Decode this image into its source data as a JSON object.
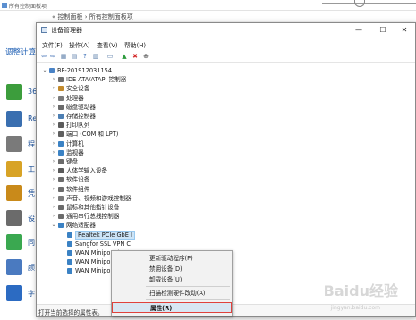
{
  "background": {
    "title": "所有控制面板项",
    "breadcrumb": "« 控制面板 › 所有控制面板项",
    "heading": "调整计算",
    "left_items": [
      {
        "text": "36",
        "color": "#3c9d3c",
        "icon": "shield-icon"
      },
      {
        "text": "Re",
        "color": "#3a6fb0",
        "icon": "users-icon"
      },
      {
        "text": "程",
        "color": "#7a7a7a",
        "icon": "program-icon"
      },
      {
        "text": "工",
        "color": "#d8a326",
        "icon": "tools-icon"
      },
      {
        "text": "凭",
        "color": "#c98a1a",
        "icon": "credential-icon"
      },
      {
        "text": "设",
        "color": "#6b6b6b",
        "icon": "device-icon"
      },
      {
        "text": "同",
        "color": "#3aa850",
        "icon": "sync-icon"
      },
      {
        "text": "颜",
        "color": "#4a7ac0",
        "icon": "display-icon"
      },
      {
        "text": "字",
        "color": "#2c6bc2",
        "icon": "font-icon"
      }
    ]
  },
  "window": {
    "title": "设备管理器",
    "controls": {
      "minimize": "—",
      "maximize": "☐",
      "close": "✕"
    }
  },
  "menu": [
    "文件(F)",
    "操作(A)",
    "查看(V)",
    "帮助(H)"
  ],
  "toolbar": [
    {
      "icon": "back-arrow-icon",
      "glyph": "⇦",
      "color": "#3b6db3"
    },
    {
      "icon": "forward-arrow-icon",
      "glyph": "⇨",
      "color": "#3b6db3"
    },
    {
      "icon": "properties-icon",
      "glyph": "▦",
      "color": "#5a7da8"
    },
    {
      "icon": "list-icon",
      "glyph": "▤",
      "color": "#5a7da8"
    },
    {
      "icon": "help-icon",
      "glyph": "?",
      "color": "#2b62b0"
    },
    {
      "icon": "view-icon",
      "glyph": "▥",
      "color": "#5a7da8"
    },
    {
      "icon": "monitor-icon",
      "glyph": "▭",
      "color": "#5a7da8"
    },
    {
      "icon": "update-driver-icon",
      "glyph": "▲",
      "color": "#2d9b3d"
    },
    {
      "icon": "uninstall-icon",
      "glyph": "✖",
      "color": "#d42b2b"
    },
    {
      "icon": "scan-download-icon",
      "glyph": "⊕",
      "color": "#333333"
    }
  ],
  "tree": {
    "root": "BF-201912031154",
    "categories": [
      {
        "label": "IDE ATA/ATAPI 控制器",
        "icon_color": "#6d6d6d",
        "icon": "ide-controller-icon"
      },
      {
        "label": "安全设备",
        "icon_color": "#c28a2b",
        "icon": "security-device-icon"
      },
      {
        "label": "处理器",
        "icon_color": "#7a7a7a",
        "icon": "processor-icon"
      },
      {
        "label": "磁盘驱动器",
        "icon_color": "#6a6a6a",
        "icon": "disk-drive-icon"
      },
      {
        "label": "存储控制器",
        "icon_color": "#4d7fb3",
        "icon": "storage-controller-icon"
      },
      {
        "label": "打印队列",
        "icon_color": "#5b5b5b",
        "icon": "print-queue-icon"
      },
      {
        "label": "端口 (COM 和 LPT)",
        "icon_color": "#5f5f5f",
        "icon": "port-icon"
      },
      {
        "label": "计算机",
        "icon_color": "#3b82c4",
        "icon": "computer-icon"
      },
      {
        "label": "监视器",
        "icon_color": "#3b82c4",
        "icon": "monitor-device-icon"
      },
      {
        "label": "键盘",
        "icon_color": "#6b6b6b",
        "icon": "keyboard-icon"
      },
      {
        "label": "人体学输入设备",
        "icon_color": "#5a5a5a",
        "icon": "hid-icon"
      },
      {
        "label": "软件设备",
        "icon_color": "#6b6b6b",
        "icon": "software-device-icon"
      },
      {
        "label": "软件组件",
        "icon_color": "#6b6b6b",
        "icon": "software-component-icon"
      },
      {
        "label": "声音、视频和游戏控制器",
        "icon_color": "#7a7a7a",
        "icon": "sound-icon"
      },
      {
        "label": "鼠标和其他指针设备",
        "icon_color": "#6b6b6b",
        "icon": "mouse-icon"
      },
      {
        "label": "通用串行总线控制器",
        "icon_color": "#6b6b6b",
        "icon": "usb-icon"
      },
      {
        "label": "网络适配器",
        "icon_color": "#3b82c4",
        "icon": "network-adapter-icon"
      }
    ],
    "network_children": [
      {
        "label": "Realtek PCIe GbE I",
        "selected": true
      },
      {
        "label": "Sangfor SSL VPN C",
        "selected": false
      },
      {
        "label": "WAN Miniport (IKE",
        "selected": false
      },
      {
        "label": "WAN Miniport (IP)",
        "selected": false
      },
      {
        "label": "WAN Miniport (IPv",
        "selected": false
      }
    ]
  },
  "context_menu": [
    "更新驱动程序(P)",
    "禁用设备(D)",
    "卸载设备(U)",
    "扫描检测硬件改动(A)",
    "属性(R)"
  ],
  "status_bar": "打开当前选择的属性表。",
  "watermark": {
    "text": "Baidu经验",
    "sub": "jingyan.baidu.com"
  }
}
